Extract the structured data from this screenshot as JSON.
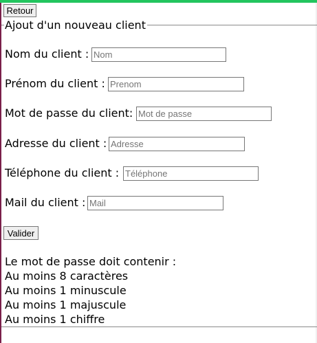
{
  "colors": {
    "accent": "#22c55e",
    "left_edge": "#7a1f4a"
  },
  "nav": {
    "back_label": "Retour"
  },
  "form": {
    "legend": "Ajout d'un nouveau client",
    "fields": [
      {
        "label": "Nom du client :",
        "placeholder": "Nom",
        "value": ""
      },
      {
        "label": "Prénom du client :",
        "placeholder": "Prenom",
        "value": ""
      },
      {
        "label": "Mot de passe du client:",
        "placeholder": "Mot de passe",
        "value": ""
      },
      {
        "label": "Adresse du client :",
        "placeholder": "Adresse",
        "value": ""
      },
      {
        "label": "Téléphone du client :",
        "placeholder": "Téléphone",
        "value": ""
      },
      {
        "label": "Mail du client :",
        "placeholder": "Mail",
        "value": ""
      }
    ],
    "submit_label": "Valider"
  },
  "password_rules": {
    "title": "Le mot de passe doit contenir :",
    "items": [
      "Au moins 8 caractères",
      "Au moins 1 minuscule",
      "Au moins 1 majuscule",
      "Au moins 1 chiffre"
    ]
  }
}
